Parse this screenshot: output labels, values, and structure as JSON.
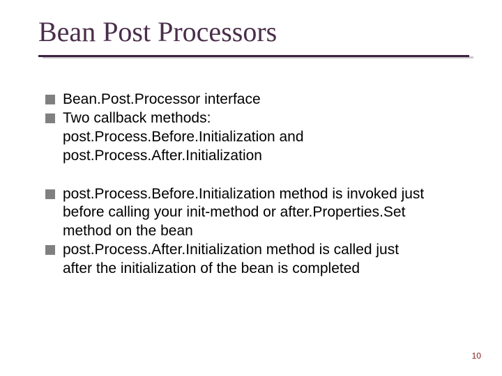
{
  "slide": {
    "title": "Bean Post Processors",
    "group1": {
      "item1": "Bean.Post.Processor interface",
      "item2": "Two callback methods:",
      "cont1": "post.Process.Before.Initialization and",
      "cont2": "post.Process.After.Initialization"
    },
    "group2": {
      "item1": "post.Process.Before.Initialization method is invoked just",
      "cont1": "before calling your init-method or after.Properties.Set",
      "cont2": "method on the bean",
      "item2": "post.Process.After.Initialization method is called just",
      "cont3": "after the initialization of the bean is completed"
    },
    "page_number": "10"
  }
}
